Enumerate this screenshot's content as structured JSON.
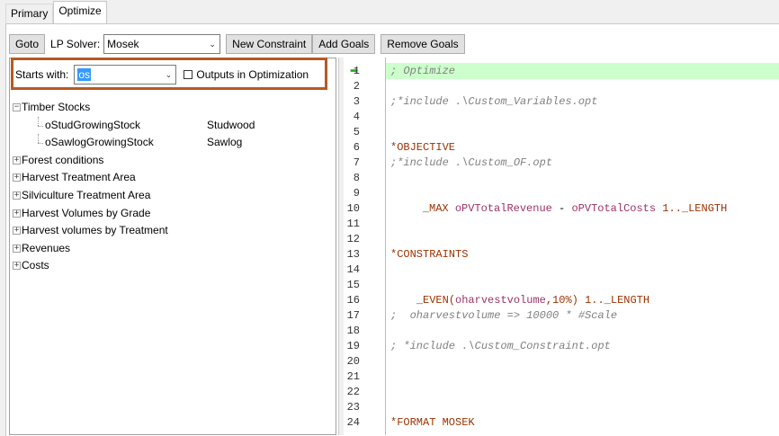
{
  "tabs": [
    {
      "label": "Primary"
    },
    {
      "label": "Optimize"
    }
  ],
  "toolbar": {
    "goto_label": "Goto",
    "lp_solver_label": "LP Solver:",
    "lp_solver_value": "Mosek",
    "new_constraint_label": "New Constraint",
    "add_goals_label": "Add Goals",
    "remove_goals_label": "Remove Goals"
  },
  "filter": {
    "starts_with_label": "Starts with:",
    "starts_with_value": "os",
    "outputs_checkbox_label": "Outputs in Optimization"
  },
  "tree": {
    "timber_stocks": "Timber Stocks",
    "child1_label": "oStudGrowingStock",
    "child1_type": "Studwood",
    "child2_label": "oSawlogGrowingStock",
    "child2_type": "Sawlog",
    "n2": "Forest conditions",
    "n3": "Harvest Treatment Area",
    "n4": "Silviculture Treatment Area",
    "n5": "Harvest Volumes by Grade",
    "n6": "Harvest volumes by Treatment",
    "n7": "Revenues",
    "n8": "Costs"
  },
  "editor": {
    "l1": "; Optimize",
    "l3": ";*include .\\Custom_Variables.opt",
    "l6": "*OBJECTIVE",
    "l7": ";*include .\\Custom_OF.opt",
    "l9a": "_MAX ",
    "l9b": "oPVTotalRevenue",
    "l9c": " - ",
    "l9d": "oPVTotalCosts",
    "l9e": " 1.._LENGTH",
    "l13": "*CONSTRAINTS",
    "l15a": "_EVEN(",
    "l15b": "oharvestvolume",
    "l15c": ",10%) 1.._LENGTH",
    "l17": ";  oharvestvolume => 10000 * #Scale",
    "l19": "; *include .\\Custom_Constraint.opt",
    "l24": "*FORMAT MOSEK",
    "line_numbers": [
      "1",
      "2",
      "3",
      "4",
      "5",
      "6",
      "7",
      "8",
      "9",
      "10",
      "11",
      "12",
      "13",
      "14",
      "15",
      "16",
      "17",
      "18",
      "19",
      "20",
      "21",
      "22",
      "23",
      "24"
    ]
  },
  "colors": {
    "highlight": "#ccffcc",
    "filter_border": "#b55a24",
    "selection": "#3399ff"
  }
}
